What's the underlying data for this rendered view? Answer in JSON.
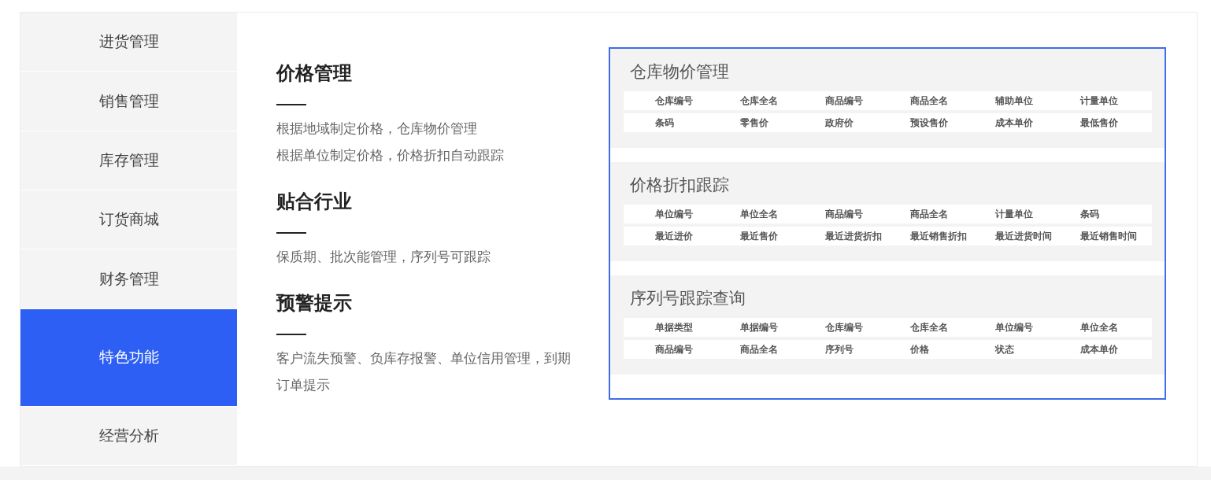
{
  "sidebar": {
    "items": [
      {
        "label": "进货管理",
        "selected": false
      },
      {
        "label": "销售管理",
        "selected": false
      },
      {
        "label": "库存管理",
        "selected": false
      },
      {
        "label": "订货商城",
        "selected": false
      },
      {
        "label": "财务管理",
        "selected": false
      },
      {
        "label": "特色功能",
        "selected": true
      },
      {
        "label": "经营分析",
        "selected": false
      }
    ]
  },
  "features": [
    {
      "title": "价格管理",
      "lines": [
        "根据地域制定价格，仓库物价管理",
        "根据单位制定价格，价格折扣自动跟踪"
      ]
    },
    {
      "title": "贴合行业",
      "lines": [
        "保质期、批次能管理，序列号可跟踪"
      ]
    },
    {
      "title": "预警提示",
      "lines": [
        "客户流失预警、负库存报警、单位信用管理，到期订单提示"
      ]
    }
  ],
  "preview": {
    "sections": [
      {
        "title": "仓库物价管理",
        "rows": [
          [
            "仓库编号",
            "仓库全名",
            "商品编号",
            "商品全名",
            "辅助单位",
            "计量单位"
          ],
          [
            "条码",
            "零售价",
            "政府价",
            "预设售价",
            "成本单价",
            "最低售价"
          ]
        ]
      },
      {
        "title": "价格折扣跟踪",
        "rows": [
          [
            "单位编号",
            "单位全名",
            "商品编号",
            "商品全名",
            "计量单位",
            "条码"
          ],
          [
            "最近进价",
            "最近售价",
            "最近进货折扣",
            "最近销售折扣",
            "最近进货时间",
            "最近销售时间"
          ]
        ]
      },
      {
        "title": "序列号跟踪查询",
        "rows": [
          [
            "单据类型",
            "单据编号",
            "仓库编号",
            "仓库全名",
            "单位编号",
            "单位全名"
          ],
          [
            "商品编号",
            "商品全名",
            "序列号",
            "价格",
            "状态",
            "成本单价"
          ]
        ]
      }
    ]
  }
}
